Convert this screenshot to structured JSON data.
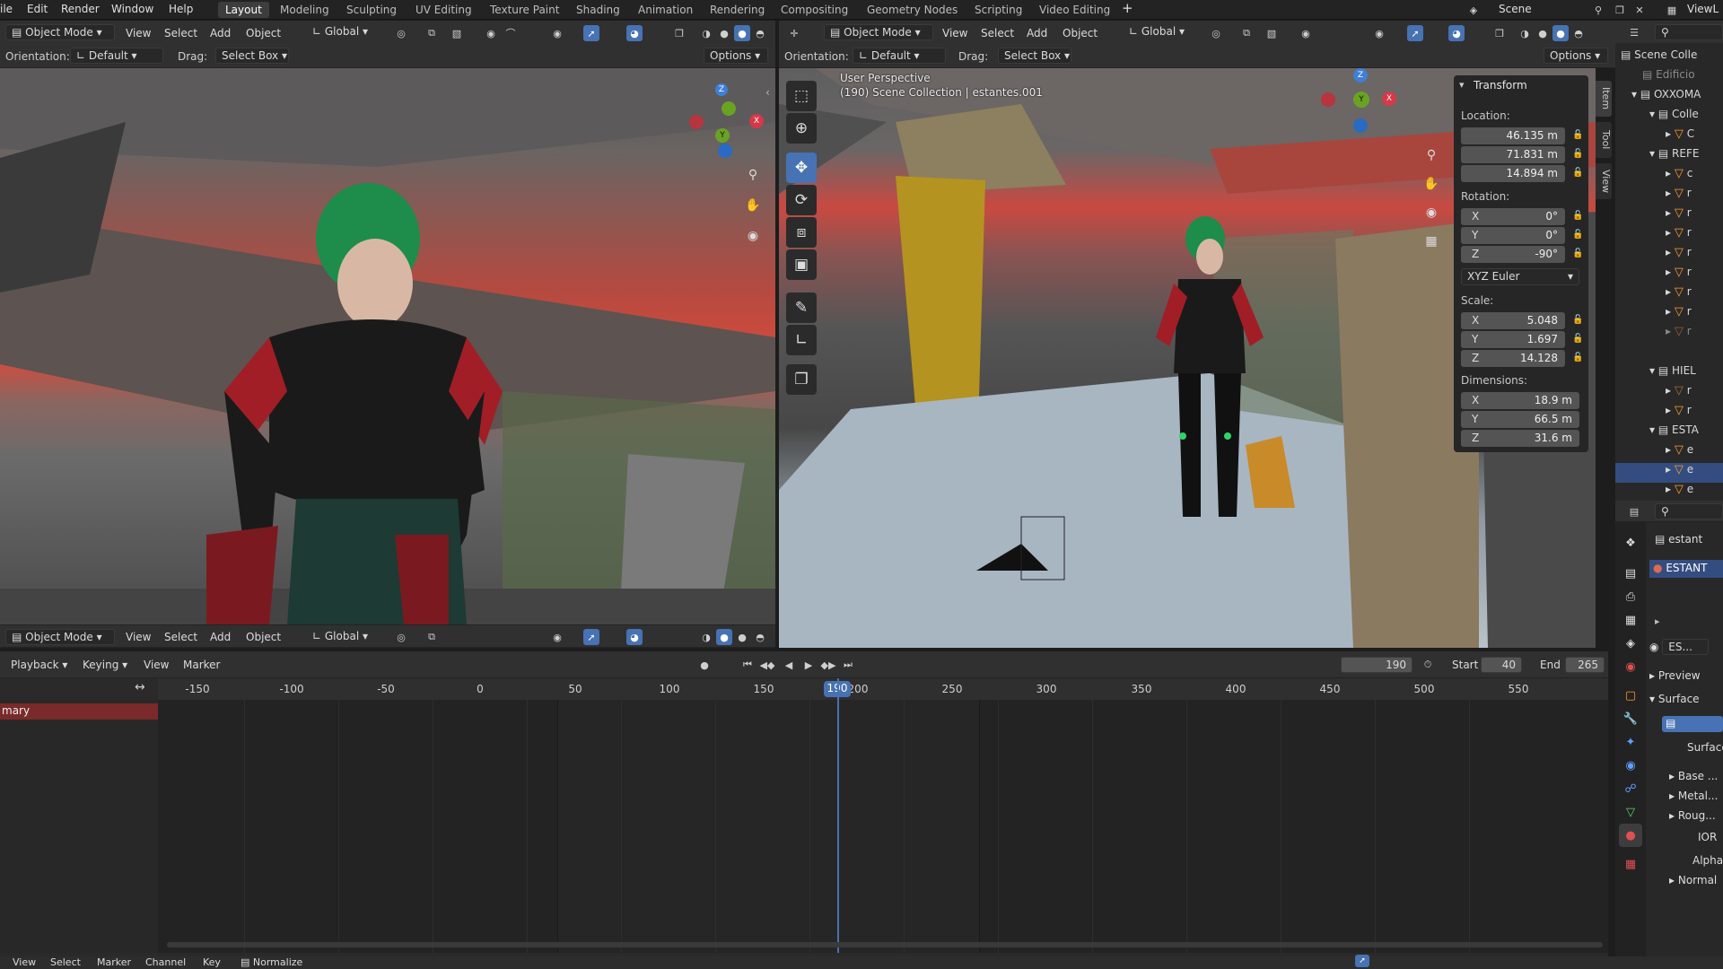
{
  "top_menu": {
    "items": [
      "ile",
      "Edit",
      "Render",
      "Window",
      "Help"
    ]
  },
  "workspaces": [
    {
      "label": "Layout",
      "active": true
    },
    {
      "label": "Modeling"
    },
    {
      "label": "Sculpting"
    },
    {
      "label": "UV Editing"
    },
    {
      "label": "Texture Paint"
    },
    {
      "label": "Shading"
    },
    {
      "label": "Animation"
    },
    {
      "label": "Rendering"
    },
    {
      "label": "Compositing"
    },
    {
      "label": "Geometry Nodes"
    },
    {
      "label": "Scripting"
    },
    {
      "label": "Video Editing"
    }
  ],
  "add_workspace_glyph": "+",
  "scene": {
    "label": "Scene",
    "view_layer": "ViewL"
  },
  "viewport_left": {
    "mode": "Object Mode",
    "menus": [
      "View",
      "Select",
      "Add",
      "Object"
    ],
    "transform_orientation": "Global",
    "orientation_label": "Orientation:",
    "orientation_value": "Default",
    "drag_label": "Drag:",
    "drag_value": "Select Box",
    "options": "Options",
    "gizmo": {
      "z": "Z",
      "y": "Y",
      "x": "X"
    }
  },
  "viewport_right": {
    "mode": "Object Mode",
    "menus": [
      "View",
      "Select",
      "Add",
      "Object"
    ],
    "transform_orientation": "Global",
    "orientation_label": "Orientation:",
    "orientation_value": "Default",
    "drag_label": "Drag:",
    "drag_value": "Select Box",
    "options": "Options",
    "overlay_line1": "User Perspective",
    "overlay_line2": "(190) Scene Collection | estantes.001",
    "gizmo": {
      "z": "Z",
      "y": "Y",
      "x": "X"
    }
  },
  "bottom_viewport_header": {
    "mode": "Object Mode",
    "menus": [
      "View",
      "Select",
      "Add",
      "Object"
    ],
    "transform_orientation": "Global"
  },
  "n_panel": {
    "title": "Transform",
    "location_label": "Location:",
    "location": [
      "46.135 m",
      "71.831 m",
      "14.894 m"
    ],
    "rotation_label": "Rotation:",
    "rotation": [
      {
        "axis": "X",
        "value": "0°"
      },
      {
        "axis": "Y",
        "value": "0°"
      },
      {
        "axis": "Z",
        "value": "-90°"
      }
    ],
    "rotation_mode": "XYZ Euler",
    "scale_label": "Scale:",
    "scale": [
      {
        "axis": "X",
        "value": "5.048"
      },
      {
        "axis": "Y",
        "value": "1.697"
      },
      {
        "axis": "Z",
        "value": "14.128"
      }
    ],
    "dimensions_label": "Dimensions:",
    "dimensions": [
      {
        "axis": "X",
        "value": "18.9 m"
      },
      {
        "axis": "Y",
        "value": "66.5 m"
      },
      {
        "axis": "Z",
        "value": "31.6 m"
      }
    ],
    "tabs": [
      "Item",
      "Tool",
      "View"
    ]
  },
  "outliner": {
    "rows": [
      {
        "label": "Scene Colle",
        "type": "scene"
      },
      {
        "label": "Edificio",
        "type": "collection"
      },
      {
        "label": "OXXOMA",
        "type": "collection"
      },
      {
        "label": "Colle",
        "type": "collection"
      },
      {
        "label": "C",
        "type": "mesh"
      },
      {
        "label": "REFE",
        "type": "collection"
      },
      {
        "label": "c",
        "type": "mesh"
      },
      {
        "label": "r",
        "type": "mesh"
      },
      {
        "label": "r",
        "type": "mesh"
      },
      {
        "label": "r",
        "type": "mesh"
      },
      {
        "label": "r",
        "type": "mesh"
      },
      {
        "label": "r",
        "type": "mesh"
      },
      {
        "label": "r",
        "type": "mesh"
      },
      {
        "label": "r",
        "type": "mesh"
      },
      {
        "label": "r",
        "type": "mesh"
      },
      {
        "label": "HIEL",
        "type": "collection"
      },
      {
        "label": "r",
        "type": "mesh"
      },
      {
        "label": "r",
        "type": "mesh"
      },
      {
        "label": "ESTA",
        "type": "collection"
      },
      {
        "label": "e",
        "type": "mesh"
      },
      {
        "label": "e",
        "type": "mesh",
        "selected": true
      },
      {
        "label": "e",
        "type": "mesh"
      }
    ]
  },
  "properties": {
    "object_name": "estant",
    "material_slot": "ESTANT",
    "material_name": "ES...",
    "sections": [
      "Preview",
      "Surface"
    ],
    "surface_label": "Surface",
    "inputs": [
      "Base ...",
      "Metal...",
      "Roug...",
      "IOR",
      "Alpha",
      "Normal"
    ]
  },
  "timeline": {
    "menus": [
      "Playback",
      "Keying",
      "View",
      "Marker"
    ],
    "current_frame": "190",
    "start_label": "Start",
    "start": "40",
    "end_label": "End",
    "end": "265",
    "ruler_ticks": [
      "-150",
      "-100",
      "-50",
      "0",
      "50",
      "100",
      "150",
      "200",
      "250",
      "300",
      "350",
      "400",
      "450",
      "500",
      "550"
    ],
    "channel": "mary",
    "current_frame_marker": "190"
  },
  "footer_menus": [
    "View",
    "Select",
    "Marker",
    "Channel",
    "Key"
  ],
  "normalize": "Normalize"
}
